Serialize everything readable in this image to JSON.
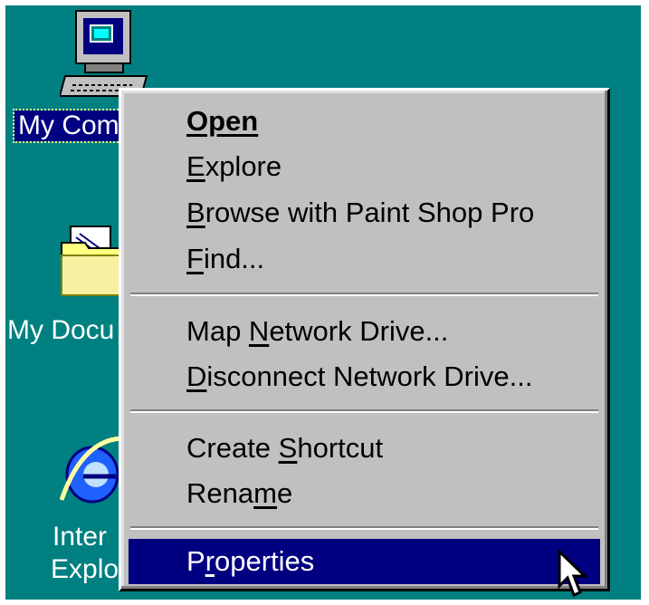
{
  "desktop": {
    "icons": [
      {
        "name": "my-computer",
        "label": "My Com"
      },
      {
        "name": "my-documents",
        "label": "My Docu"
      },
      {
        "name": "internet-explorer",
        "label_line1": "Inter",
        "label_line2": "Explo"
      }
    ],
    "background_color": "#008080"
  },
  "context_menu": {
    "items": [
      {
        "before": "",
        "key": "Open",
        "after": ""
      },
      {
        "before": "",
        "key": "E",
        "after": "xplore"
      },
      {
        "before": "",
        "key": "B",
        "after": "rowse with Paint Shop Pro"
      },
      {
        "before": "",
        "key": "F",
        "after": "ind..."
      },
      {
        "before": "Map ",
        "key": "N",
        "after": "etwork Drive..."
      },
      {
        "before": "",
        "key": "D",
        "after": "isconnect Network Drive..."
      },
      {
        "before": "Create ",
        "key": "S",
        "after": "hortcut"
      },
      {
        "before": "Rena",
        "key": "m",
        "after": "e"
      },
      {
        "before": "P",
        "key": "r",
        "after": "operties"
      }
    ],
    "highlight_color": "#000080"
  }
}
